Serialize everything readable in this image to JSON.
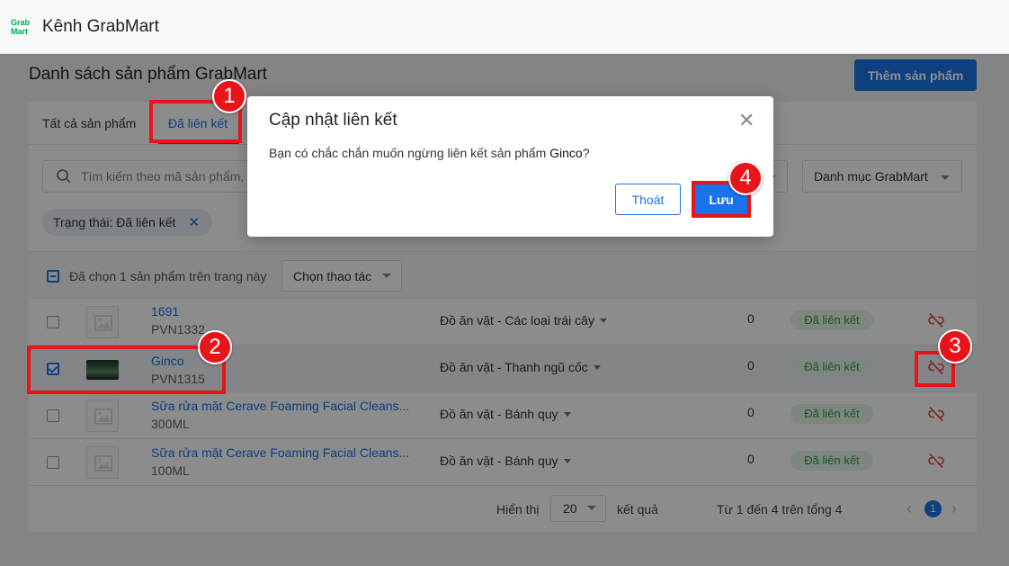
{
  "app": {
    "logo_line1": "Grab",
    "logo_line2": "Mart",
    "title": "Kênh GrabMart"
  },
  "page": {
    "title": "Danh sách sản phẩm GrabMart",
    "add_button": "Thêm sản phẩm"
  },
  "tabs": [
    {
      "label": "Tất cả sản phẩm"
    },
    {
      "label": "Đã liên kết"
    }
  ],
  "search": {
    "placeholder": "Tìm kiếm theo mã sản phẩm, tên sản phẩm"
  },
  "filters": {
    "category_dropdown": "Danh mục GrabMart"
  },
  "chip": {
    "label": "Trạng thái: Đã liên kết",
    "close": "✕"
  },
  "bulk": {
    "selected_text": "Đã chọn 1 sản phẩm trên trang này",
    "action_label": "Chọn thao tác"
  },
  "rows": [
    {
      "name": "1691",
      "sku": "PVN1332",
      "category": "Đồ ăn vặt - Các loại trái cây",
      "qty": "0",
      "status": "Đã liên kết",
      "checked": false
    },
    {
      "name": "Ginco",
      "sku": "PVN1315",
      "category": "Đồ ăn vặt - Thanh ngũ cốc",
      "qty": "0",
      "status": "Đã liên kết",
      "checked": true
    },
    {
      "name": "Sữa rửa mặt Cerave Foaming Facial Cleans...",
      "sku": "300ML",
      "category": "Đồ ăn vặt - Bánh quy",
      "qty": "0",
      "status": "Đã liên kết",
      "checked": false
    },
    {
      "name": "Sữa rửa mặt Cerave Foaming Facial Cleans...",
      "sku": "100ML",
      "category": "Đồ ăn vặt - Bánh quy",
      "qty": "0",
      "status": "Đã liên kết",
      "checked": false
    }
  ],
  "footer": {
    "show_label": "Hiển thị",
    "page_size": "20",
    "results_label": "kết quả",
    "range_text": "Từ 1 đến 4 trên tổng 4",
    "current_page": "1",
    "prev": "‹",
    "next": "›"
  },
  "modal": {
    "title": "Cập nhật liên kết",
    "close": "✕",
    "message_prefix": "Bạn có chắc chắn muốn ngừng liên kết sản phẩm ",
    "product": "Ginco",
    "message_suffix": "?",
    "cancel_label": "Thoát",
    "save_label": "Lưu"
  },
  "annotations": {
    "step1": "1",
    "step2": "2",
    "step3": "3",
    "step4": "4"
  },
  "colors": {
    "primary": "#1a73e8",
    "highlight": "#e8141a",
    "unlink_icon": "#e05a5a",
    "status_bg": "#e6f5ea",
    "status_text": "#2e9e55",
    "brand_green": "#00a94f"
  },
  "icons": {
    "search": "search-icon",
    "unlink": "link-off-icon",
    "image_placeholder": "image-placeholder-icon",
    "close": "close-icon",
    "checkbox": "checkbox-icon"
  }
}
